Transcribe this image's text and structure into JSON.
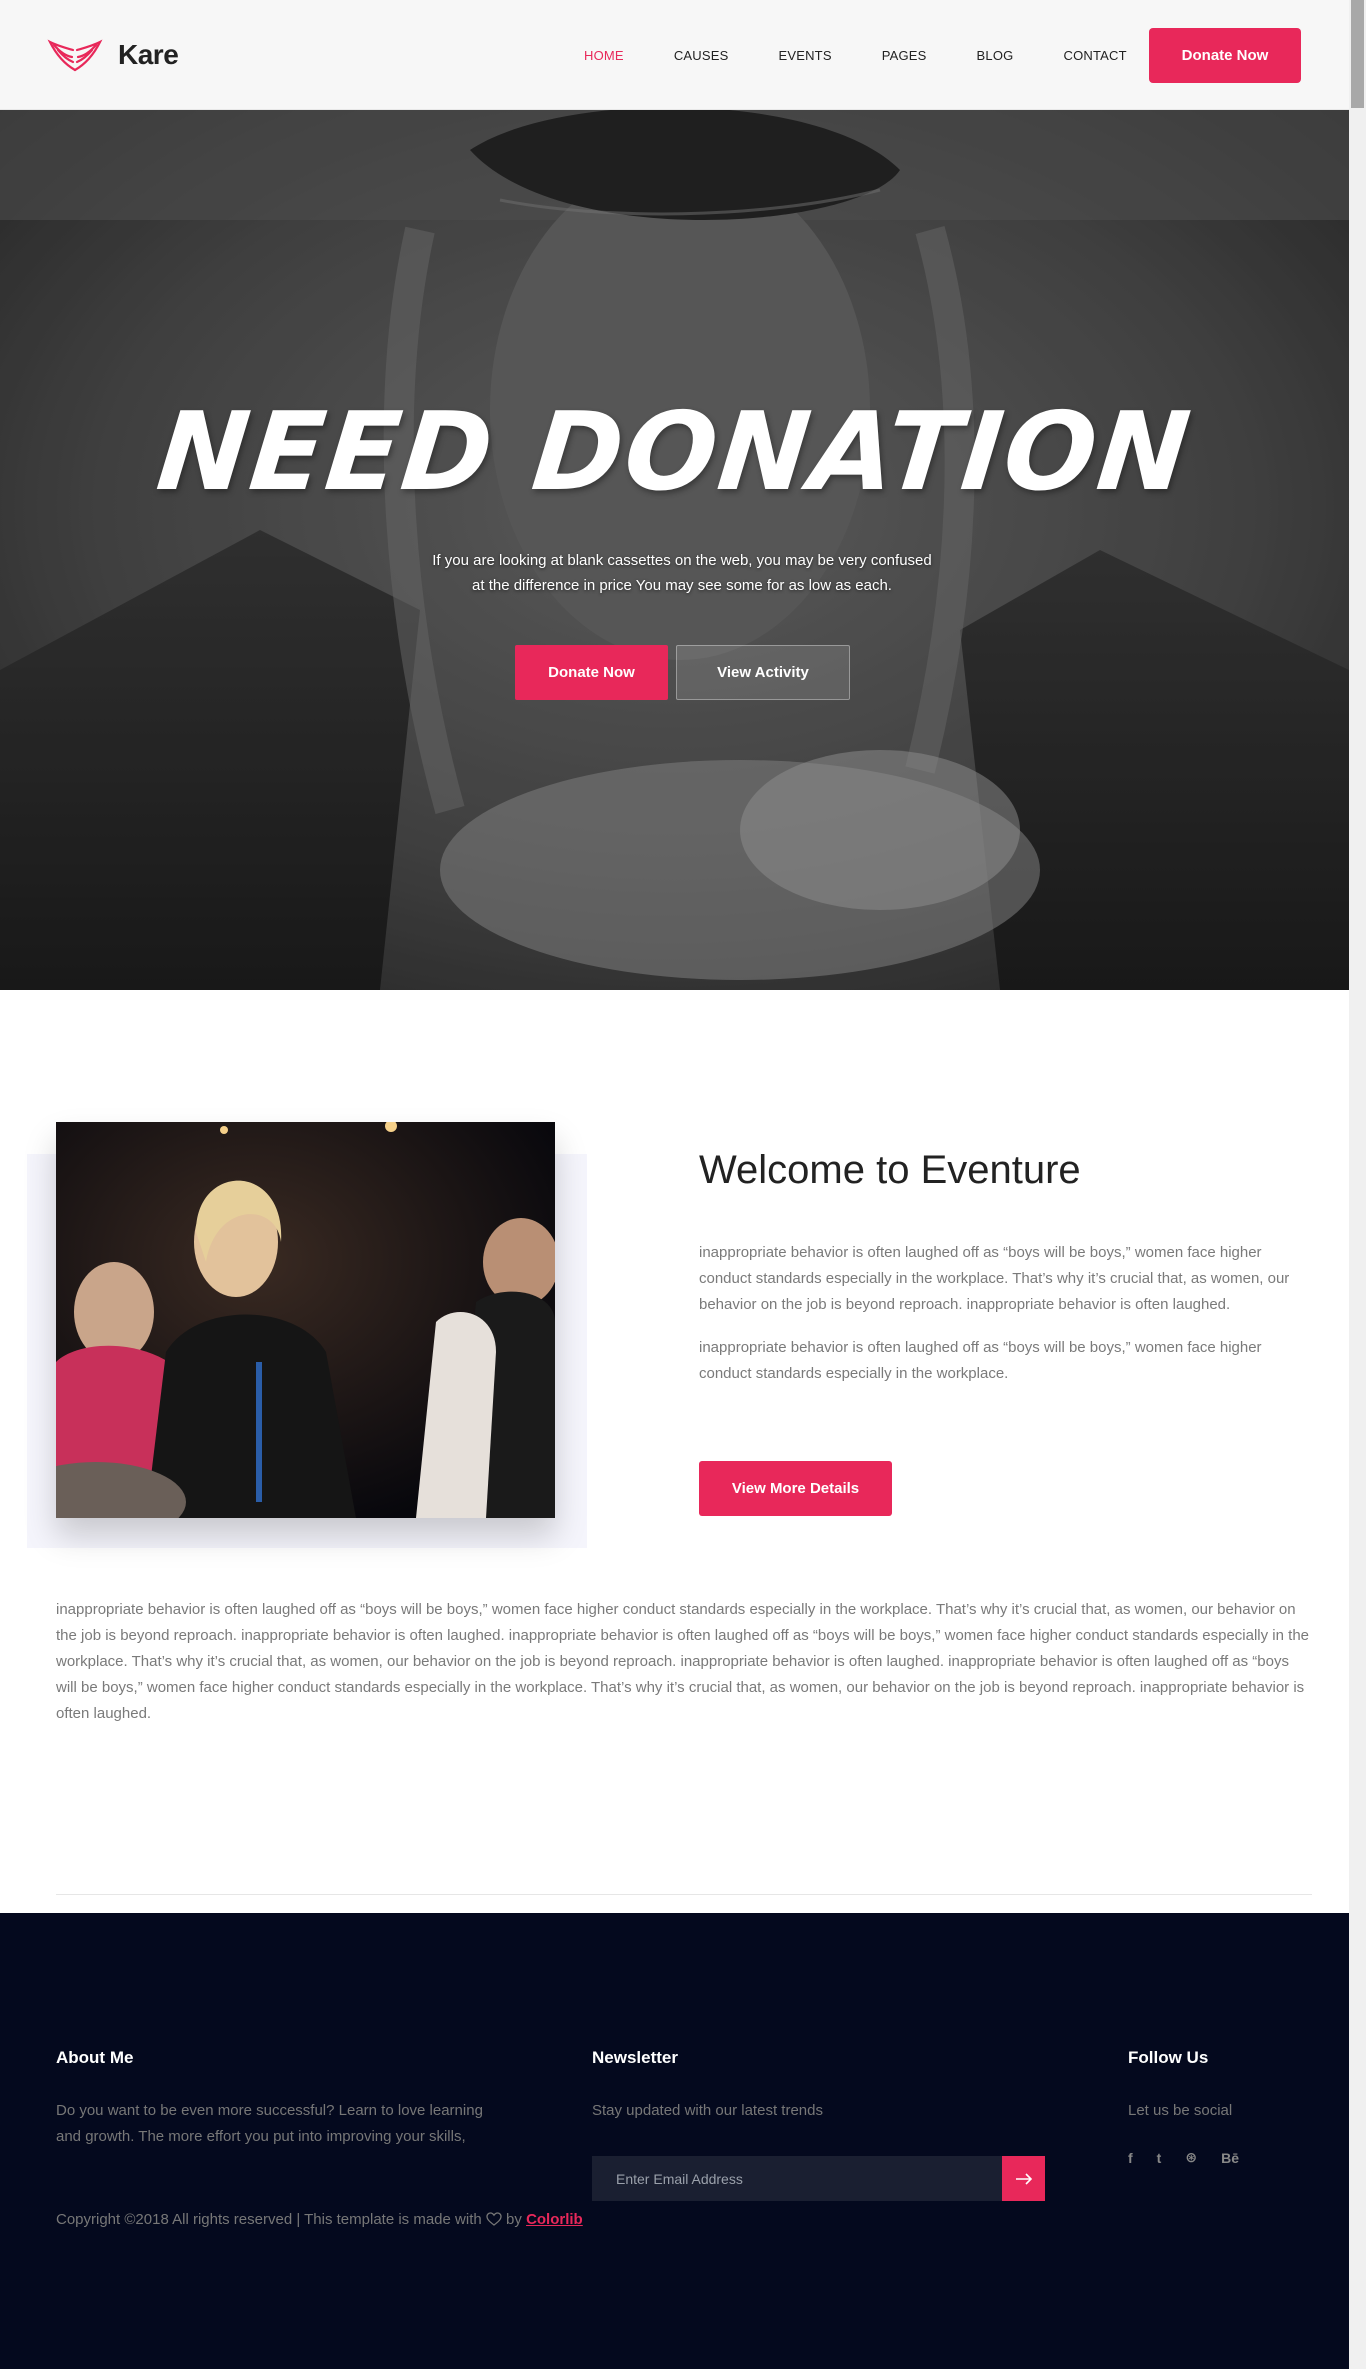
{
  "header": {
    "logo_text": "Kare",
    "nav": [
      "HOME",
      "CAUSES",
      "EVENTS",
      "PAGES",
      "BLOG",
      "CONTACT"
    ],
    "active_nav": "HOME",
    "donate_label": "Donate Now"
  },
  "hero": {
    "title": "NEED DONATION",
    "subtitle_line1": "If you are looking at blank cassettes on the web, you may be very confused",
    "subtitle_line2": "at the difference in price You may see some for as low as each.",
    "donate_label": "Donate Now",
    "activity_label": "View Activity"
  },
  "welcome": {
    "title": "Welcome to Eventure",
    "para1": "inappropriate behavior is often laughed off as “boys will be boys,” women face higher conduct standards especially in the workplace. That’s why it’s crucial that, as women, our behavior on the job is beyond reproach. inappropriate behavior is often laughed.",
    "para2": "inappropriate behavior is often laughed off as “boys will be boys,” women face higher conduct standards especially in the workplace.",
    "button_label": "View More Details",
    "long_text": "inappropriate behavior is often laughed off as “boys will be boys,” women face higher conduct standards especially in the workplace. That’s why it’s crucial that, as women, our behavior on the job is beyond reproach. inappropriate behavior is often laughed. inappropriate behavior is often laughed off as “boys will be boys,” women face higher conduct standards especially in the workplace. That’s why it’s crucial that, as women, our behavior on the job is beyond reproach. inappropriate behavior is often laughed. inappropriate behavior is often laughed off as “boys will be boys,” women face higher conduct standards especially in the workplace. That’s why it’s crucial that, as women, our behavior on the job is beyond reproach. inappropriate behavior is often laughed."
  },
  "footer": {
    "about_title": "About Me",
    "about_text": "Do you want to be even more successful? Learn to love learning and growth. The more effort you put into improving your skills,",
    "newsletter_title": "Newsletter",
    "newsletter_text": "Stay updated with our latest trends",
    "email_placeholder": "Enter Email Address",
    "follow_title": "Follow Us",
    "follow_text": "Let us be social",
    "social_icons": [
      "facebook-icon",
      "twitter-icon",
      "dribbble-icon",
      "behance-icon"
    ],
    "social_glyphs": [
      "f",
      "t",
      "⊛",
      "Bē"
    ],
    "copyright_prefix": "Copyright ©2018 All rights reserved | This template is made with",
    "copyright_by": "by",
    "copyright_brand": "Colorlib"
  },
  "colors": {
    "accent": "#e8285a",
    "footer_bg": "#04091e"
  }
}
